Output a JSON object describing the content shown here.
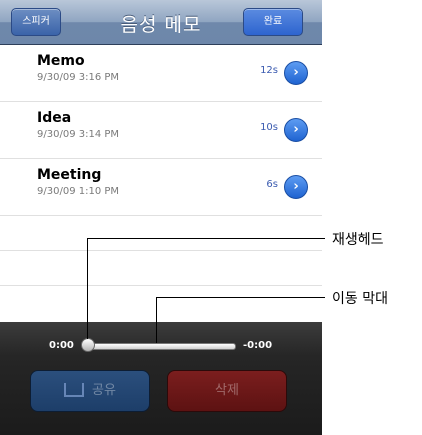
{
  "navbar": {
    "title": "음성 메모",
    "left_button": "스피커",
    "right_button": "완료"
  },
  "memos": [
    {
      "title": "Memo",
      "date": "9/30/09 3:16 PM",
      "duration": "12s"
    },
    {
      "title": "Idea",
      "date": "9/30/09 3:14 PM",
      "duration": "10s"
    },
    {
      "title": "Meeting",
      "date": "9/30/09 1:10 PM",
      "duration": "6s"
    }
  ],
  "playback": {
    "elapsed": "0:00",
    "remaining": "-0:00",
    "progress": 0
  },
  "buttons": {
    "share": "공유",
    "delete": "삭제"
  },
  "callouts": {
    "playhead": "재생헤드",
    "scrubber": "이동 막대"
  }
}
